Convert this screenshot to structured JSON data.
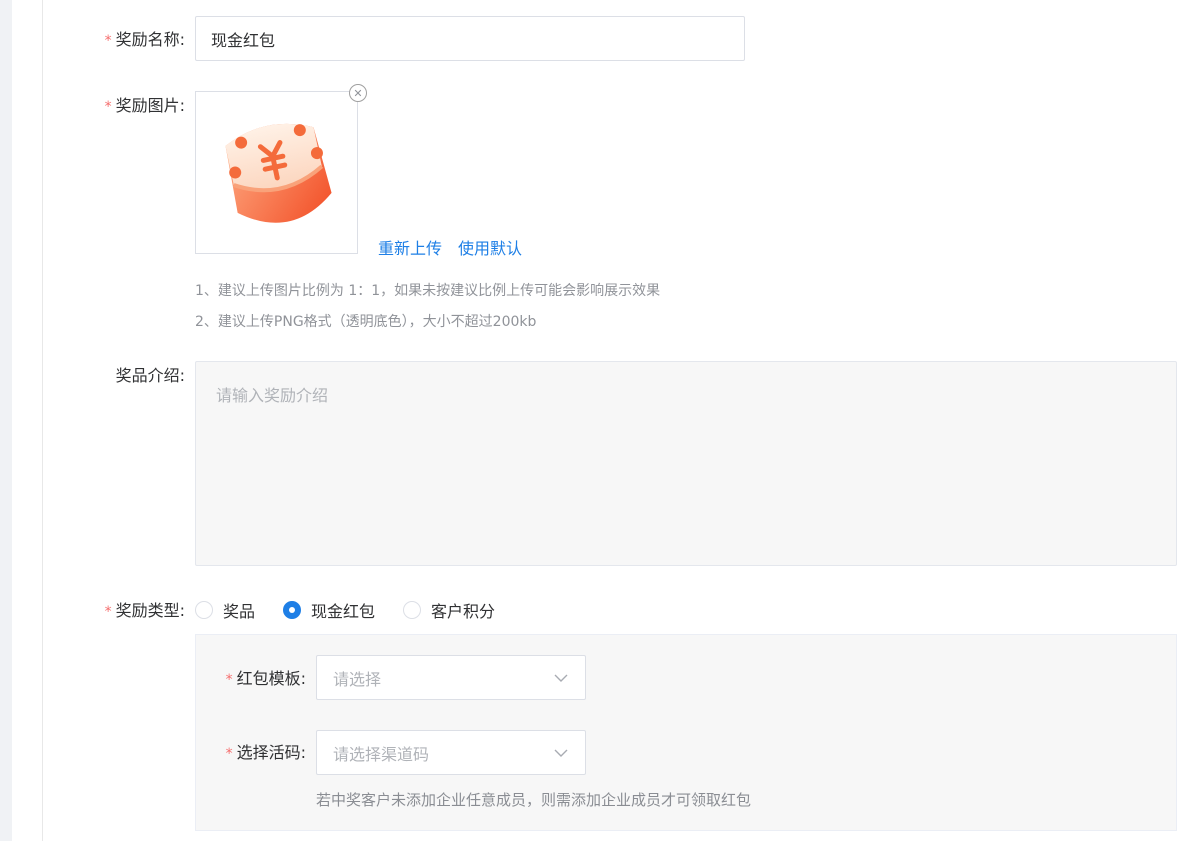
{
  "form": {
    "reward_name": {
      "label": "奖励名称:",
      "required": "*",
      "value": "现金红包"
    },
    "reward_image": {
      "label": "奖励图片:",
      "required": "*",
      "remove_icon": "close-circle-icon",
      "reupload": "重新上传",
      "use_default": "使用默认",
      "tips": [
        "1、建议上传图片比例为 1：1，如果未按建议比例上传可能会影响展示效果",
        "2、建议上传PNG格式（透明底色），大小不超过200kb"
      ]
    },
    "prize_intro": {
      "label": "奖品介绍:",
      "placeholder": "请输入奖励介绍"
    },
    "reward_type": {
      "label": "奖励类型:",
      "required": "*",
      "options": [
        {
          "label": "奖品",
          "checked": false
        },
        {
          "label": "现金红包",
          "checked": true
        },
        {
          "label": "客户积分",
          "checked": false
        }
      ]
    },
    "red_packet_template": {
      "label": "红包模板:",
      "required": "*",
      "placeholder": "请选择"
    },
    "select_code": {
      "label": "选择活码:",
      "required": "*",
      "placeholder": "请选择渠道码",
      "hint": "若中奖客户未添加企业任意成员，则需添加企业成员才可领取红包"
    }
  },
  "colors": {
    "accent": "#1e7fe6",
    "required": "#f56c6c",
    "image_primary": "#f46b3b"
  }
}
